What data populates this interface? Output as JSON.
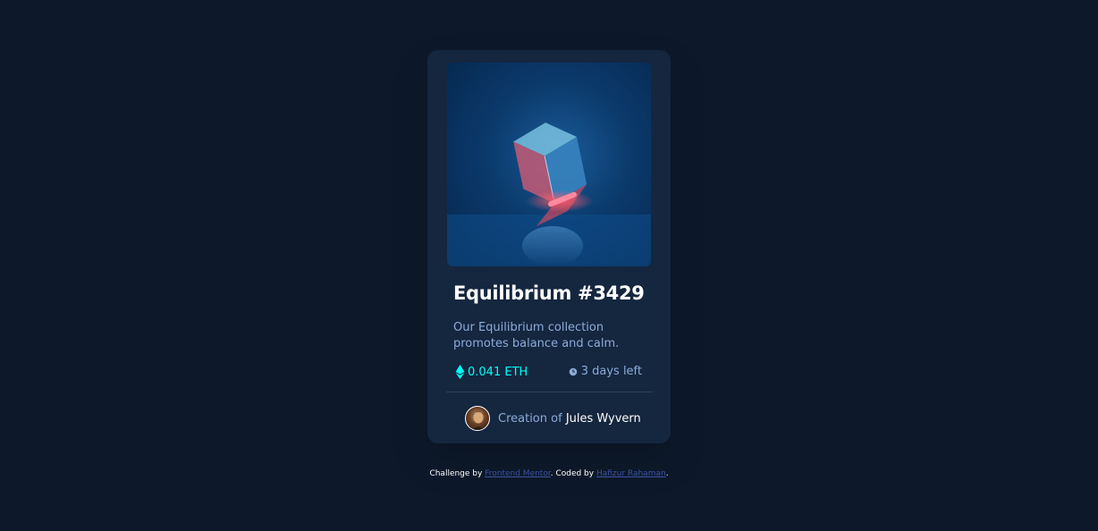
{
  "card": {
    "image_alt": "Equilibrium cube",
    "title": "Equilibrium #3429",
    "description": "Our Equilibrium collection promotes balance and calm.",
    "price": "0.041 ETH",
    "time_left": "3 days left",
    "creator_prefix": "Creation of",
    "creator_name": "Jules Wyvern"
  },
  "attribution": {
    "challenge_prefix": "Challenge by",
    "challenge_link": "Frontend Mentor",
    "coded_prefix": ". Coded by",
    "coder_link": "Hafizur Rahaman",
    "suffix": "."
  },
  "colors": {
    "page_bg": "#0d192b",
    "card_bg": "#15263f",
    "accent_cyan": "#00fff8",
    "soft_blue": "#8bacd9",
    "link_blue": "#3e52a3"
  },
  "icons": {
    "price": "ethereum-icon",
    "time": "clock-icon"
  }
}
